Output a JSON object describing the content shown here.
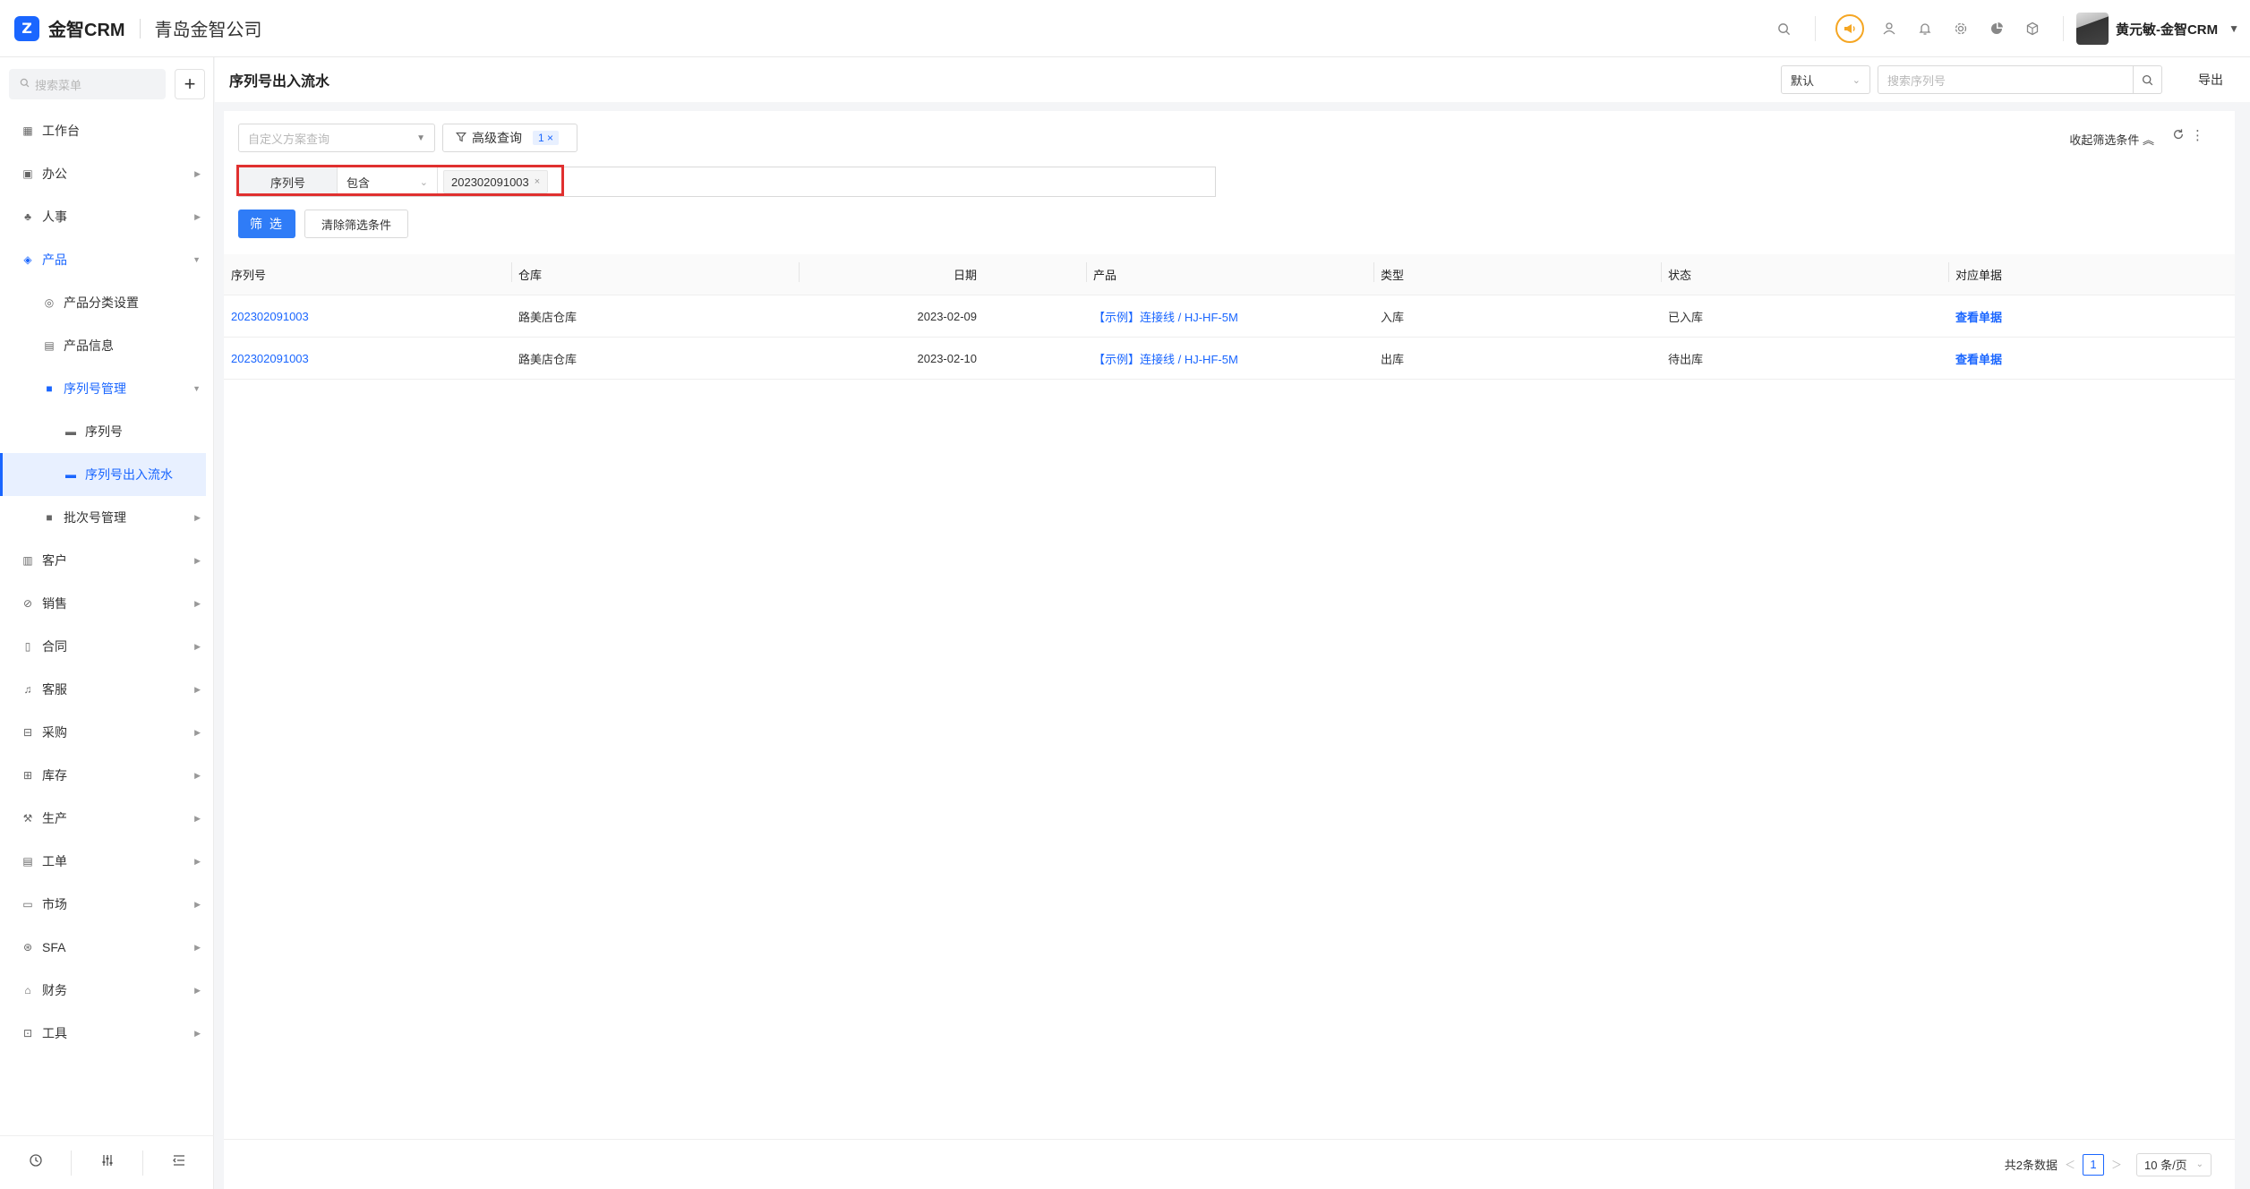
{
  "header": {
    "logo_mark": "Z",
    "app_name": "金智CRM",
    "company": "青岛金智公司",
    "user_name": "黄元敏-金智CRM"
  },
  "sidebar": {
    "search_placeholder": "搜索菜单",
    "add_label": "+",
    "items": [
      {
        "label": "工作台"
      },
      {
        "label": "办公"
      },
      {
        "label": "人事"
      },
      {
        "label": "产品"
      },
      {
        "label": "产品分类设置"
      },
      {
        "label": "产品信息"
      },
      {
        "label": "序列号管理"
      },
      {
        "label": "序列号"
      },
      {
        "label": "序列号出入流水"
      },
      {
        "label": "批次号管理"
      },
      {
        "label": "客户"
      },
      {
        "label": "销售"
      },
      {
        "label": "合同"
      },
      {
        "label": "客服"
      },
      {
        "label": "采购"
      },
      {
        "label": "库存"
      },
      {
        "label": "生产"
      },
      {
        "label": "工单"
      },
      {
        "label": "市场"
      },
      {
        "label": "SFA"
      },
      {
        "label": "财务"
      },
      {
        "label": "工具"
      }
    ]
  },
  "page": {
    "title": "序列号出入流水",
    "view_select": "默认",
    "search_placeholder": "搜索序列号",
    "export_label": "导出"
  },
  "filter": {
    "scheme_placeholder": "自定义方案查询",
    "advanced_label": "高级查询",
    "advanced_count": "1",
    "collapse_label": "收起筛选条件",
    "condition": {
      "field": "序列号",
      "operator": "包含",
      "value": "202302091003"
    },
    "apply_label": "筛 选",
    "clear_label": "清除筛选条件"
  },
  "table": {
    "columns": [
      "序列号",
      "仓库",
      "日期",
      "产品",
      "类型",
      "状态",
      "对应单据"
    ],
    "rows": [
      {
        "serial": "202302091003",
        "warehouse": "路美店仓库",
        "date": "2023-02-09",
        "product": "【示例】连接线 / HJ-HF-5M",
        "type": "入库",
        "status": "已入库",
        "doc": "查看单据"
      },
      {
        "serial": "202302091003",
        "warehouse": "路美店仓库",
        "date": "2023-02-10",
        "product": "【示例】连接线 / HJ-HF-5M",
        "type": "出库",
        "status": "待出库",
        "doc": "查看单据"
      }
    ]
  },
  "pagination": {
    "total": "共2条数据",
    "current_page": "1",
    "page_size": "10 条/页"
  },
  "colors": {
    "primary": "#1a66ff",
    "highlight_box": "#e0302f",
    "accent_icon": "#f5a623"
  }
}
